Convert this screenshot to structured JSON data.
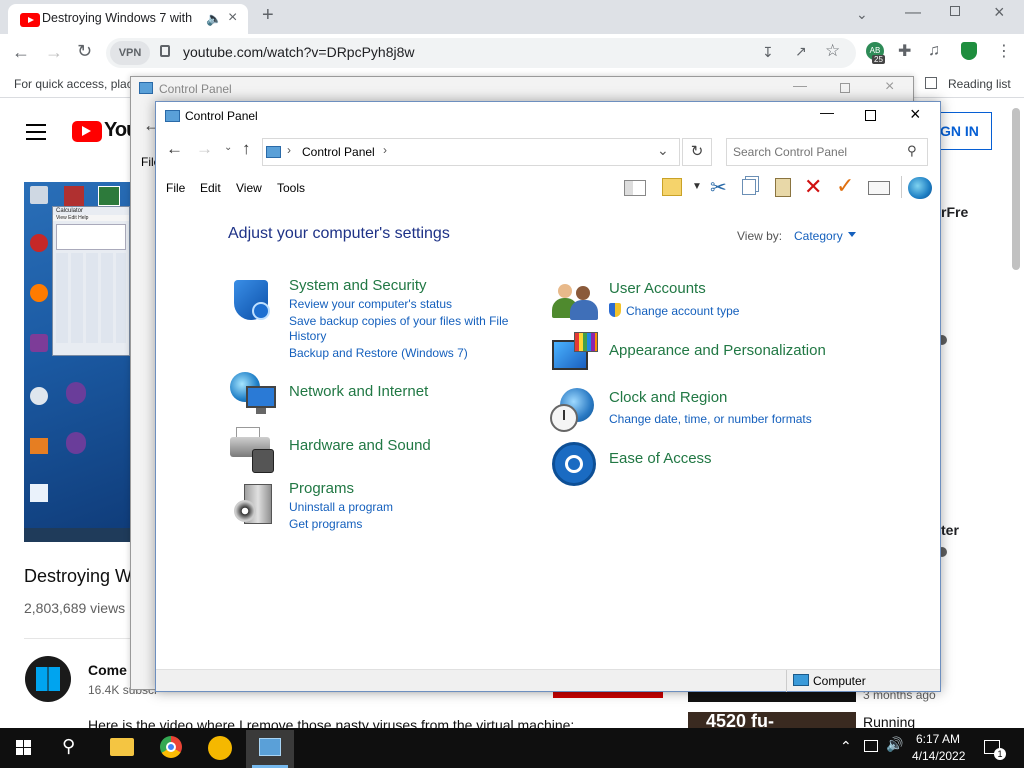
{
  "browser": {
    "tab_title": "Destroying Windows 7 with",
    "url": "youtube.com/watch?v=DRpcPyh8j8w",
    "vpn_label": "VPN",
    "bookmarks_hint": "For quick access, plac",
    "reading_list": "Reading list",
    "extension_badge": "25",
    "extension_label": "AB"
  },
  "youtube": {
    "logo_text": "You",
    "sign_in": "GN IN",
    "video_title": "Destroying W",
    "views": "2,803,689 views",
    "channel_name": "Come on W",
    "subscribers": "16.4K subscr",
    "description": "Here is the video where I remove those nasty viruses from the virtual machine:",
    "side_text_1": "rFre",
    "side_text_2": "ter",
    "side_meta": "3 months ago",
    "side_running": "Running",
    "side_thumb_text": "4520 fu-"
  },
  "cp_back": {
    "title": "Control Panel",
    "file_label": "File"
  },
  "control_panel": {
    "title": "Control Panel",
    "breadcrumb": "Control Panel",
    "search_placeholder": "Search Control Panel",
    "menu": [
      "File",
      "Edit",
      "View",
      "Tools"
    ],
    "heading": "Adjust your computer's settings",
    "view_by_label": "View by:",
    "view_by_value": "Category",
    "left_categories": [
      {
        "title": "System and Security",
        "links": [
          "Review your computer's status",
          "Save backup copies of your files with File",
          "History",
          "Backup and Restore (Windows 7)"
        ],
        "icon": "shield-icon"
      },
      {
        "title": "Network and Internet",
        "links": [],
        "icon": "globe-network-icon"
      },
      {
        "title": "Hardware and Sound",
        "links": [],
        "icon": "printer-icon"
      },
      {
        "title": "Programs",
        "links": [
          "Uninstall a program",
          "Get programs"
        ],
        "icon": "programs-icon"
      }
    ],
    "right_categories": [
      {
        "title": "User Accounts",
        "links": [
          "Change account type"
        ],
        "icon": "users-icon"
      },
      {
        "title": "Appearance and Personalization",
        "links": [],
        "icon": "monitor-palette-icon"
      },
      {
        "title": "Clock and Region",
        "links": [
          "Change date, time, or number formats"
        ],
        "icon": "clock-globe-icon"
      },
      {
        "title": "Ease of Access",
        "links": [],
        "icon": "ease-of-access-icon"
      }
    ],
    "status_text": "Computer"
  },
  "desktop_thumb": {
    "calc_title": "Calculator",
    "calc_menu": "View Edit Help"
  },
  "taskbar": {
    "time": "6:17 AM",
    "date": "4/14/2022",
    "notification_count": "1"
  }
}
